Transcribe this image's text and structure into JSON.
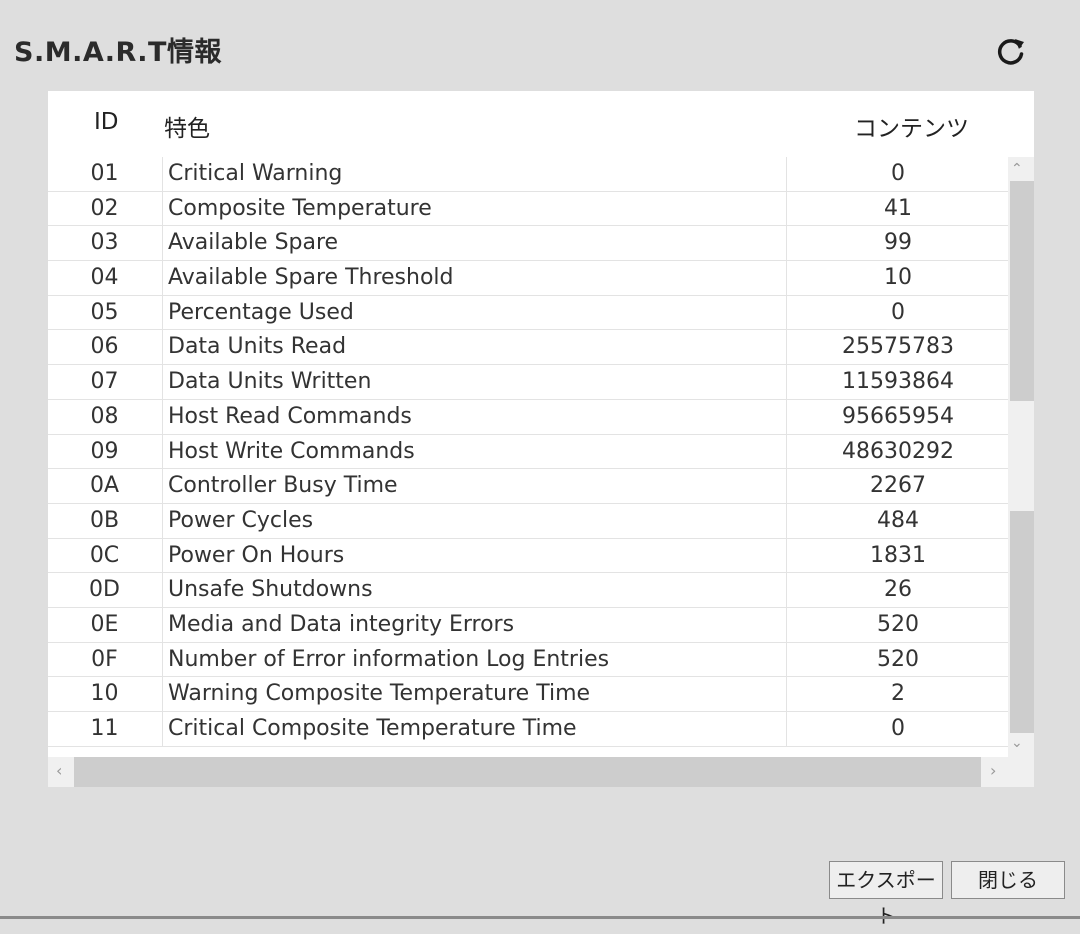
{
  "window": {
    "title": "S.M.A.R.T情報"
  },
  "icons": {
    "refresh": "refresh-icon",
    "scroll_up": "chevron-up-icon",
    "scroll_down": "chevron-down-icon",
    "scroll_left": "chevron-left-icon",
    "scroll_right": "chevron-right-icon"
  },
  "table": {
    "headers": {
      "id": "ID",
      "attribute": "特色",
      "value": "コンテンツ"
    },
    "rows": [
      {
        "id": "01",
        "attribute": "Critical Warning",
        "value": "0"
      },
      {
        "id": "02",
        "attribute": "Composite Temperature",
        "value": "41"
      },
      {
        "id": "03",
        "attribute": "Available Spare",
        "value": "99"
      },
      {
        "id": "04",
        "attribute": "Available Spare Threshold",
        "value": "10"
      },
      {
        "id": "05",
        "attribute": "Percentage Used",
        "value": "0"
      },
      {
        "id": "06",
        "attribute": "Data Units Read",
        "value": "25575783"
      },
      {
        "id": "07",
        "attribute": "Data Units Written",
        "value": "11593864"
      },
      {
        "id": "08",
        "attribute": "Host Read Commands",
        "value": "95665954"
      },
      {
        "id": "09",
        "attribute": "Host Write Commands",
        "value": "48630292"
      },
      {
        "id": "0A",
        "attribute": "Controller Busy Time",
        "value": "2267"
      },
      {
        "id": "0B",
        "attribute": "Power Cycles",
        "value": "484"
      },
      {
        "id": "0C",
        "attribute": "Power On Hours",
        "value": "1831"
      },
      {
        "id": "0D",
        "attribute": "Unsafe Shutdowns",
        "value": "26"
      },
      {
        "id": "0E",
        "attribute": "Media and Data integrity Errors",
        "value": "520"
      },
      {
        "id": "0F",
        "attribute": "Number of Error information Log Entries",
        "value": "520"
      },
      {
        "id": "10",
        "attribute": "Warning Composite Temperature Time",
        "value": "2"
      },
      {
        "id": "11",
        "attribute": "Critical Composite Temperature Time",
        "value": "0"
      }
    ]
  },
  "buttons": {
    "export": "エクスポート",
    "close": "閉じる"
  },
  "colors": {
    "background": "#dedede",
    "panel": "#ffffff",
    "scroll_thumb": "#cdcdcd",
    "scroll_track": "#f0f0f0"
  }
}
